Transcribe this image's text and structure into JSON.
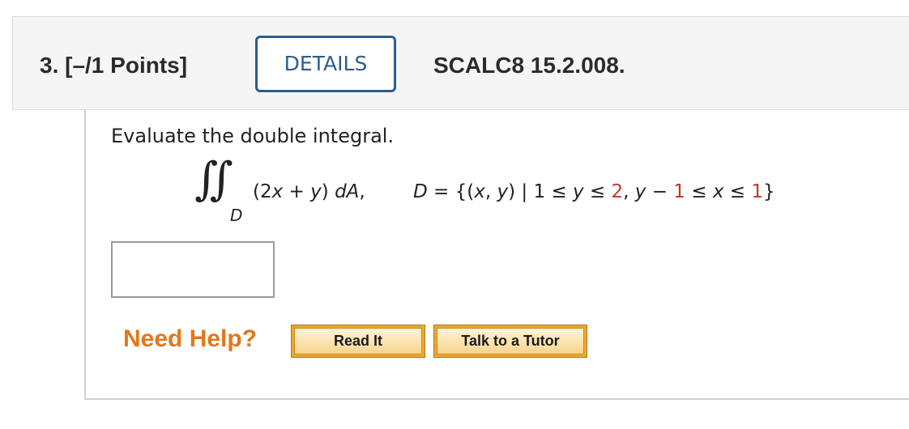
{
  "question": {
    "number_label": "3. [–/1 Points]",
    "details_button": "DETAILS",
    "code": "SCALC8 15.2.008."
  },
  "body": {
    "prompt": "Evaluate the double integral.",
    "integral_symbol": "∬",
    "integral_subscript": "D",
    "integrand": {
      "open": "(2",
      "x1": "x",
      "plus": " + ",
      "y1": "y",
      "close": ") ",
      "dA": "dA",
      "comma": ","
    },
    "domain": {
      "D": "D",
      "eq_open": " = {(",
      "x": "x",
      "comma1": ", ",
      "y": "y",
      "bar": ") | 1 ≤ ",
      "y2": "y",
      "le_two": " ≤ ",
      "two": "2",
      "comma2": ", ",
      "y3": "y",
      "minus": " − ",
      "one_red": "1",
      "le3": " ≤ ",
      "x2": "x",
      "le4": " ≤ ",
      "one_red2": "1",
      "close": "}"
    },
    "answer_value": ""
  },
  "help": {
    "label": "Need Help?",
    "read_it": "Read It",
    "talk_to_tutor": "Talk to a Tutor"
  },
  "colors": {
    "details_border": "#2e5d8f",
    "need_help": "#e3771c",
    "highlight_red": "#c0392b",
    "help_button_outer": "#f5a623"
  }
}
